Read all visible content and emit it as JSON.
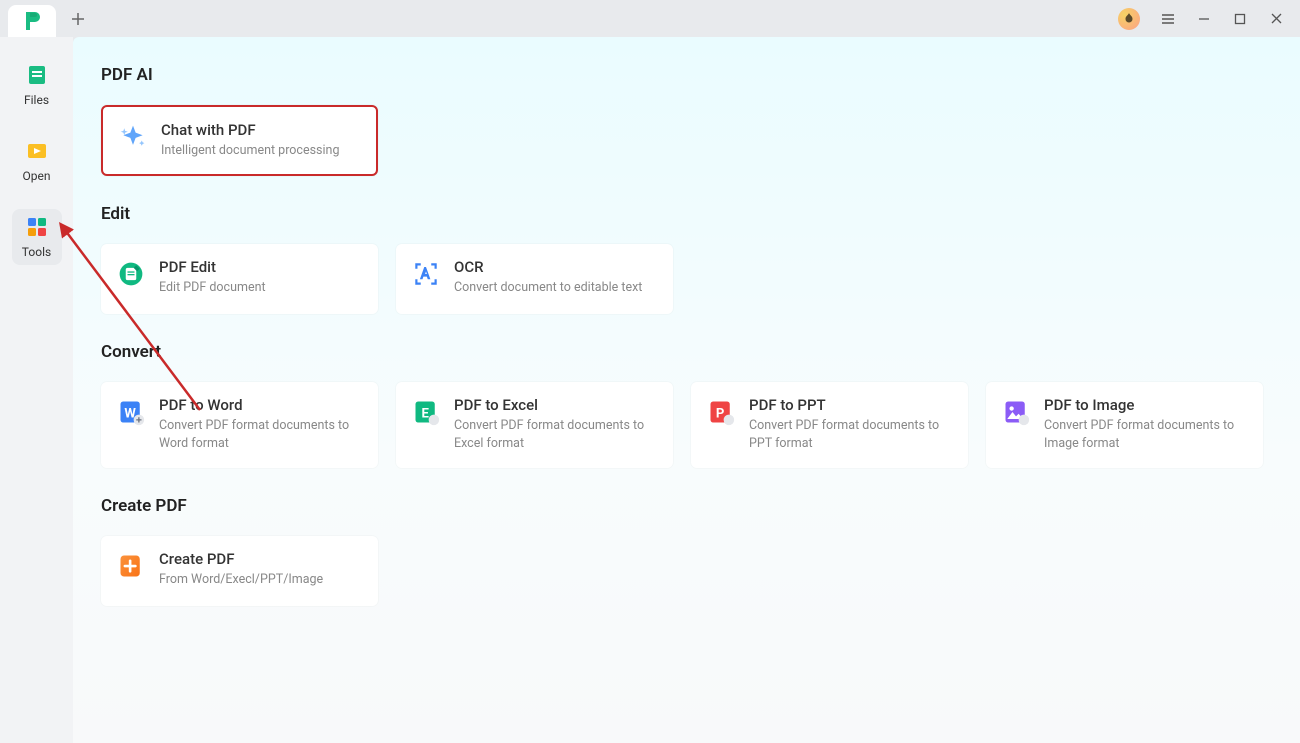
{
  "sidebar": {
    "files": "Files",
    "open": "Open",
    "tools": "Tools"
  },
  "sections": {
    "pdfai": {
      "title": "PDF AI",
      "chat": {
        "title": "Chat with PDF",
        "sub": "Intelligent document processing"
      }
    },
    "edit": {
      "title": "Edit",
      "pdfedit": {
        "title": "PDF Edit",
        "sub": "Edit PDF document"
      },
      "ocr": {
        "title": "OCR",
        "sub": "Convert document to editable text"
      }
    },
    "convert": {
      "title": "Convert",
      "word": {
        "title": "PDF to Word",
        "sub": "Convert PDF format documents to Word format"
      },
      "excel": {
        "title": "PDF to Excel",
        "sub": "Convert PDF format documents to Excel format"
      },
      "ppt": {
        "title": "PDF to PPT",
        "sub": "Convert PDF format documents to PPT format"
      },
      "image": {
        "title": "PDF to Image",
        "sub": "Convert PDF format documents to Image format"
      }
    },
    "create": {
      "title": "Create PDF",
      "create": {
        "title": "Create PDF",
        "sub": "From Word/Execl/PPT/Image"
      }
    }
  }
}
